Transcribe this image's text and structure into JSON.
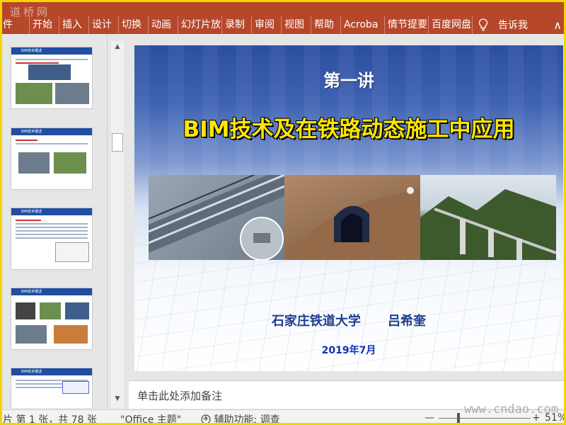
{
  "watermark": {
    "top_logo": "道桥网",
    "bottom_url": "www.cndao.com"
  },
  "ribbon": {
    "tabs": [
      "件",
      "开始",
      "插入",
      "设计",
      "切换",
      "动画",
      "幻灯片放",
      "录制",
      "审阅",
      "视图",
      "帮助",
      "Acroba",
      "情节提要",
      "百度网盘"
    ],
    "tell_me": "告诉我",
    "collapse_glyph": "∧"
  },
  "thumbnails": [
    {
      "title": "BIM技术概述"
    },
    {
      "title": "BIM技术概述"
    },
    {
      "title": "BIM技术概述"
    },
    {
      "title": "BIM技术概述"
    },
    {
      "title": "BIM技术概述"
    }
  ],
  "slide": {
    "lecture": "第一讲",
    "title": "BIM技术及在铁路动态施工中应用",
    "school": "石家庄铁道大学",
    "author": "吕希奎",
    "date": "2019年7月"
  },
  "notes_placeholder": "单击此处添加备注",
  "status": {
    "slide_count": "片 第 1 张，共 78 张",
    "theme": "\"Office 主题\"",
    "accessibility": "辅助功能: 调查",
    "zoom_minus": "—",
    "zoom_plus": "+",
    "zoom_value": "51%"
  },
  "colors": {
    "ribbon": "#b7472a",
    "title_yellow": "#ffe600",
    "author_blue": "#1f3e8f"
  }
}
